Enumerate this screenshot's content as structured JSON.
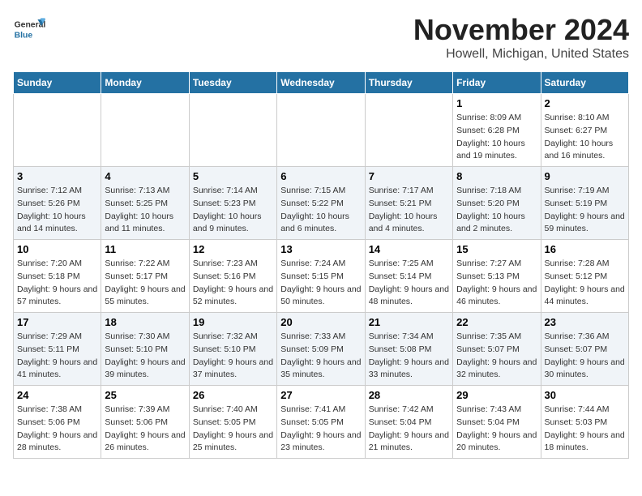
{
  "header": {
    "logo_general": "General",
    "logo_blue": "Blue",
    "month_title": "November 2024",
    "location": "Howell, Michigan, United States"
  },
  "days_of_week": [
    "Sunday",
    "Monday",
    "Tuesday",
    "Wednesday",
    "Thursday",
    "Friday",
    "Saturday"
  ],
  "weeks": [
    [
      {
        "day": "",
        "info": ""
      },
      {
        "day": "",
        "info": ""
      },
      {
        "day": "",
        "info": ""
      },
      {
        "day": "",
        "info": ""
      },
      {
        "day": "",
        "info": ""
      },
      {
        "day": "1",
        "info": "Sunrise: 8:09 AM\nSunset: 6:28 PM\nDaylight: 10 hours and 19 minutes."
      },
      {
        "day": "2",
        "info": "Sunrise: 8:10 AM\nSunset: 6:27 PM\nDaylight: 10 hours and 16 minutes."
      }
    ],
    [
      {
        "day": "3",
        "info": "Sunrise: 7:12 AM\nSunset: 5:26 PM\nDaylight: 10 hours and 14 minutes."
      },
      {
        "day": "4",
        "info": "Sunrise: 7:13 AM\nSunset: 5:25 PM\nDaylight: 10 hours and 11 minutes."
      },
      {
        "day": "5",
        "info": "Sunrise: 7:14 AM\nSunset: 5:23 PM\nDaylight: 10 hours and 9 minutes."
      },
      {
        "day": "6",
        "info": "Sunrise: 7:15 AM\nSunset: 5:22 PM\nDaylight: 10 hours and 6 minutes."
      },
      {
        "day": "7",
        "info": "Sunrise: 7:17 AM\nSunset: 5:21 PM\nDaylight: 10 hours and 4 minutes."
      },
      {
        "day": "8",
        "info": "Sunrise: 7:18 AM\nSunset: 5:20 PM\nDaylight: 10 hours and 2 minutes."
      },
      {
        "day": "9",
        "info": "Sunrise: 7:19 AM\nSunset: 5:19 PM\nDaylight: 9 hours and 59 minutes."
      }
    ],
    [
      {
        "day": "10",
        "info": "Sunrise: 7:20 AM\nSunset: 5:18 PM\nDaylight: 9 hours and 57 minutes."
      },
      {
        "day": "11",
        "info": "Sunrise: 7:22 AM\nSunset: 5:17 PM\nDaylight: 9 hours and 55 minutes."
      },
      {
        "day": "12",
        "info": "Sunrise: 7:23 AM\nSunset: 5:16 PM\nDaylight: 9 hours and 52 minutes."
      },
      {
        "day": "13",
        "info": "Sunrise: 7:24 AM\nSunset: 5:15 PM\nDaylight: 9 hours and 50 minutes."
      },
      {
        "day": "14",
        "info": "Sunrise: 7:25 AM\nSunset: 5:14 PM\nDaylight: 9 hours and 48 minutes."
      },
      {
        "day": "15",
        "info": "Sunrise: 7:27 AM\nSunset: 5:13 PM\nDaylight: 9 hours and 46 minutes."
      },
      {
        "day": "16",
        "info": "Sunrise: 7:28 AM\nSunset: 5:12 PM\nDaylight: 9 hours and 44 minutes."
      }
    ],
    [
      {
        "day": "17",
        "info": "Sunrise: 7:29 AM\nSunset: 5:11 PM\nDaylight: 9 hours and 41 minutes."
      },
      {
        "day": "18",
        "info": "Sunrise: 7:30 AM\nSunset: 5:10 PM\nDaylight: 9 hours and 39 minutes."
      },
      {
        "day": "19",
        "info": "Sunrise: 7:32 AM\nSunset: 5:10 PM\nDaylight: 9 hours and 37 minutes."
      },
      {
        "day": "20",
        "info": "Sunrise: 7:33 AM\nSunset: 5:09 PM\nDaylight: 9 hours and 35 minutes."
      },
      {
        "day": "21",
        "info": "Sunrise: 7:34 AM\nSunset: 5:08 PM\nDaylight: 9 hours and 33 minutes."
      },
      {
        "day": "22",
        "info": "Sunrise: 7:35 AM\nSunset: 5:07 PM\nDaylight: 9 hours and 32 minutes."
      },
      {
        "day": "23",
        "info": "Sunrise: 7:36 AM\nSunset: 5:07 PM\nDaylight: 9 hours and 30 minutes."
      }
    ],
    [
      {
        "day": "24",
        "info": "Sunrise: 7:38 AM\nSunset: 5:06 PM\nDaylight: 9 hours and 28 minutes."
      },
      {
        "day": "25",
        "info": "Sunrise: 7:39 AM\nSunset: 5:06 PM\nDaylight: 9 hours and 26 minutes."
      },
      {
        "day": "26",
        "info": "Sunrise: 7:40 AM\nSunset: 5:05 PM\nDaylight: 9 hours and 25 minutes."
      },
      {
        "day": "27",
        "info": "Sunrise: 7:41 AM\nSunset: 5:05 PM\nDaylight: 9 hours and 23 minutes."
      },
      {
        "day": "28",
        "info": "Sunrise: 7:42 AM\nSunset: 5:04 PM\nDaylight: 9 hours and 21 minutes."
      },
      {
        "day": "29",
        "info": "Sunrise: 7:43 AM\nSunset: 5:04 PM\nDaylight: 9 hours and 20 minutes."
      },
      {
        "day": "30",
        "info": "Sunrise: 7:44 AM\nSunset: 5:03 PM\nDaylight: 9 hours and 18 minutes."
      }
    ]
  ]
}
